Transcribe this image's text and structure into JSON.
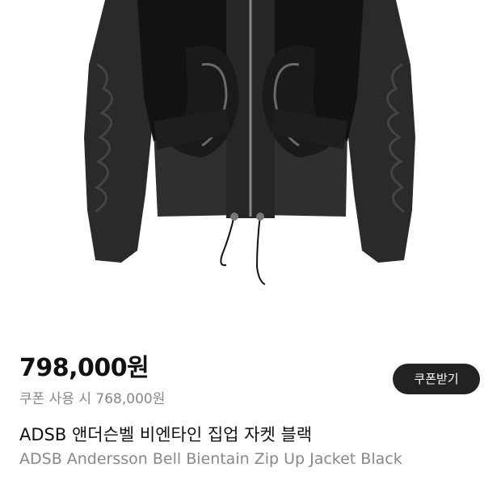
{
  "product": {
    "image": {
      "subject": "jacket-image",
      "colors": {
        "body": "#2b2b2b",
        "velvet": "#111111",
        "shine": "#5a5a5a"
      }
    },
    "price": "798,000원",
    "coupon_price": "쿠폰 사용 시 768,000원",
    "coupon_button_label": "쿠폰받기",
    "name_kr": "ADSB 앤더슨벨 비엔타인 집업 자켓 블랙",
    "name_en": "ADSB Andersson Bell Bientain Zip Up Jacket Black"
  },
  "colors": {
    "price_text": "#111111",
    "secondary_text": "#888888",
    "button_bg": "#222222",
    "button_text": "#ffffff"
  }
}
